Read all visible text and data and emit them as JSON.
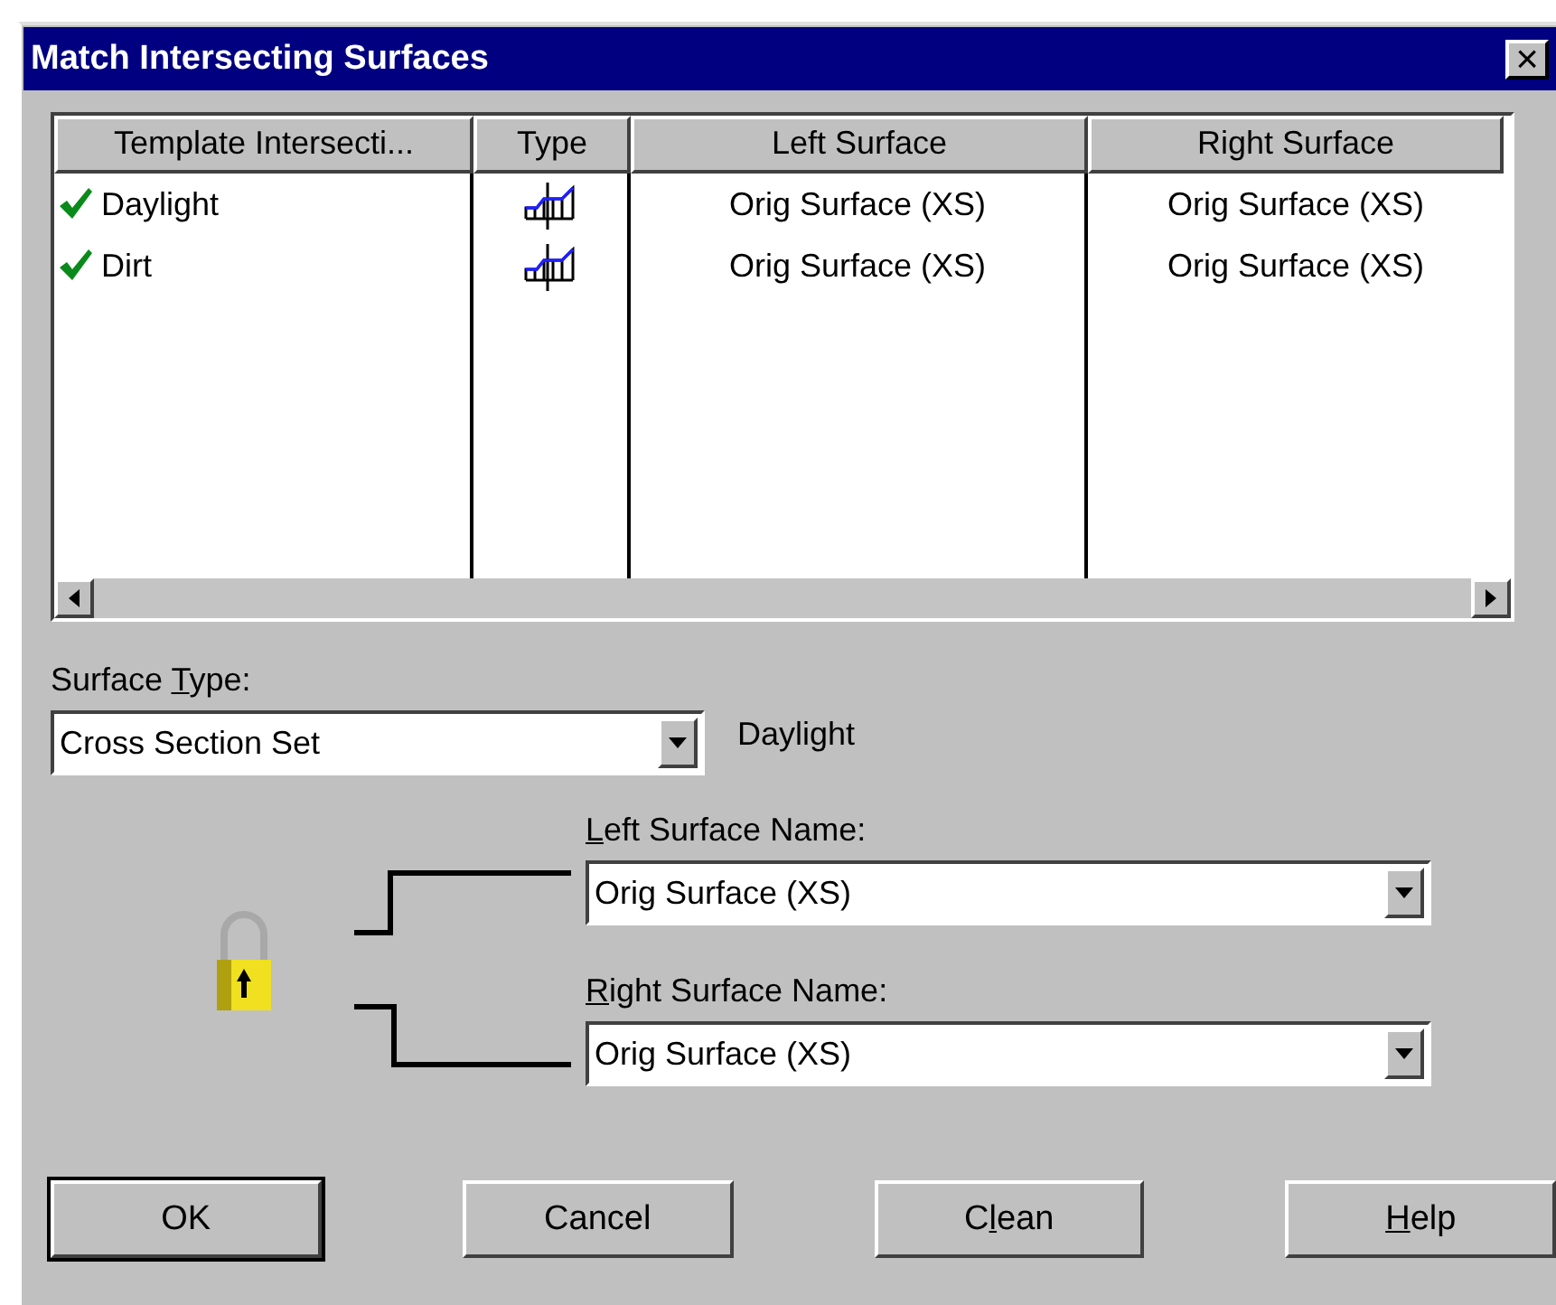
{
  "window": {
    "title": "Match Intersecting Surfaces",
    "close_glyph": "×"
  },
  "table": {
    "columns": [
      "Template Intersecti...",
      "Type",
      "Left Surface",
      "Right Surface"
    ],
    "rows": [
      {
        "checked": true,
        "template": "Daylight",
        "left": "Orig Surface (XS)",
        "right": "Orig Surface (XS)"
      },
      {
        "checked": true,
        "template": "Dirt",
        "left": "Orig Surface (XS)",
        "right": "Orig Surface (XS)"
      }
    ]
  },
  "surface_type": {
    "label": [
      {
        "text": "Surface ",
        "underlined": false
      },
      {
        "text": "T",
        "underlined": true
      },
      {
        "text": "ype:",
        "underlined": false
      }
    ],
    "value": "Cross Section Set"
  },
  "current_template": "Daylight",
  "left_surface": {
    "label": [
      {
        "text": "L",
        "underlined": true
      },
      {
        "text": "eft Surface Name:",
        "underlined": false
      }
    ],
    "value": "Orig Surface (XS)"
  },
  "right_surface": {
    "label": [
      {
        "text": "R",
        "underlined": true
      },
      {
        "text": "ight Surface Name:",
        "underlined": false
      }
    ],
    "value": "Orig Surface (XS)"
  },
  "buttons": [
    {
      "label": [
        {
          "text": "OK",
          "underlined": false
        }
      ],
      "default": true
    },
    {
      "label": [
        {
          "text": "Cancel",
          "underlined": false
        }
      ],
      "default": false
    },
    {
      "label": [
        {
          "text": "C",
          "underlined": false
        },
        {
          "text": "l",
          "underlined": true
        },
        {
          "text": "ean",
          "underlined": false
        }
      ],
      "default": false
    },
    {
      "label": [
        {
          "text": "H",
          "underlined": true
        },
        {
          "text": "elp",
          "underlined": false
        }
      ],
      "default": false
    }
  ]
}
